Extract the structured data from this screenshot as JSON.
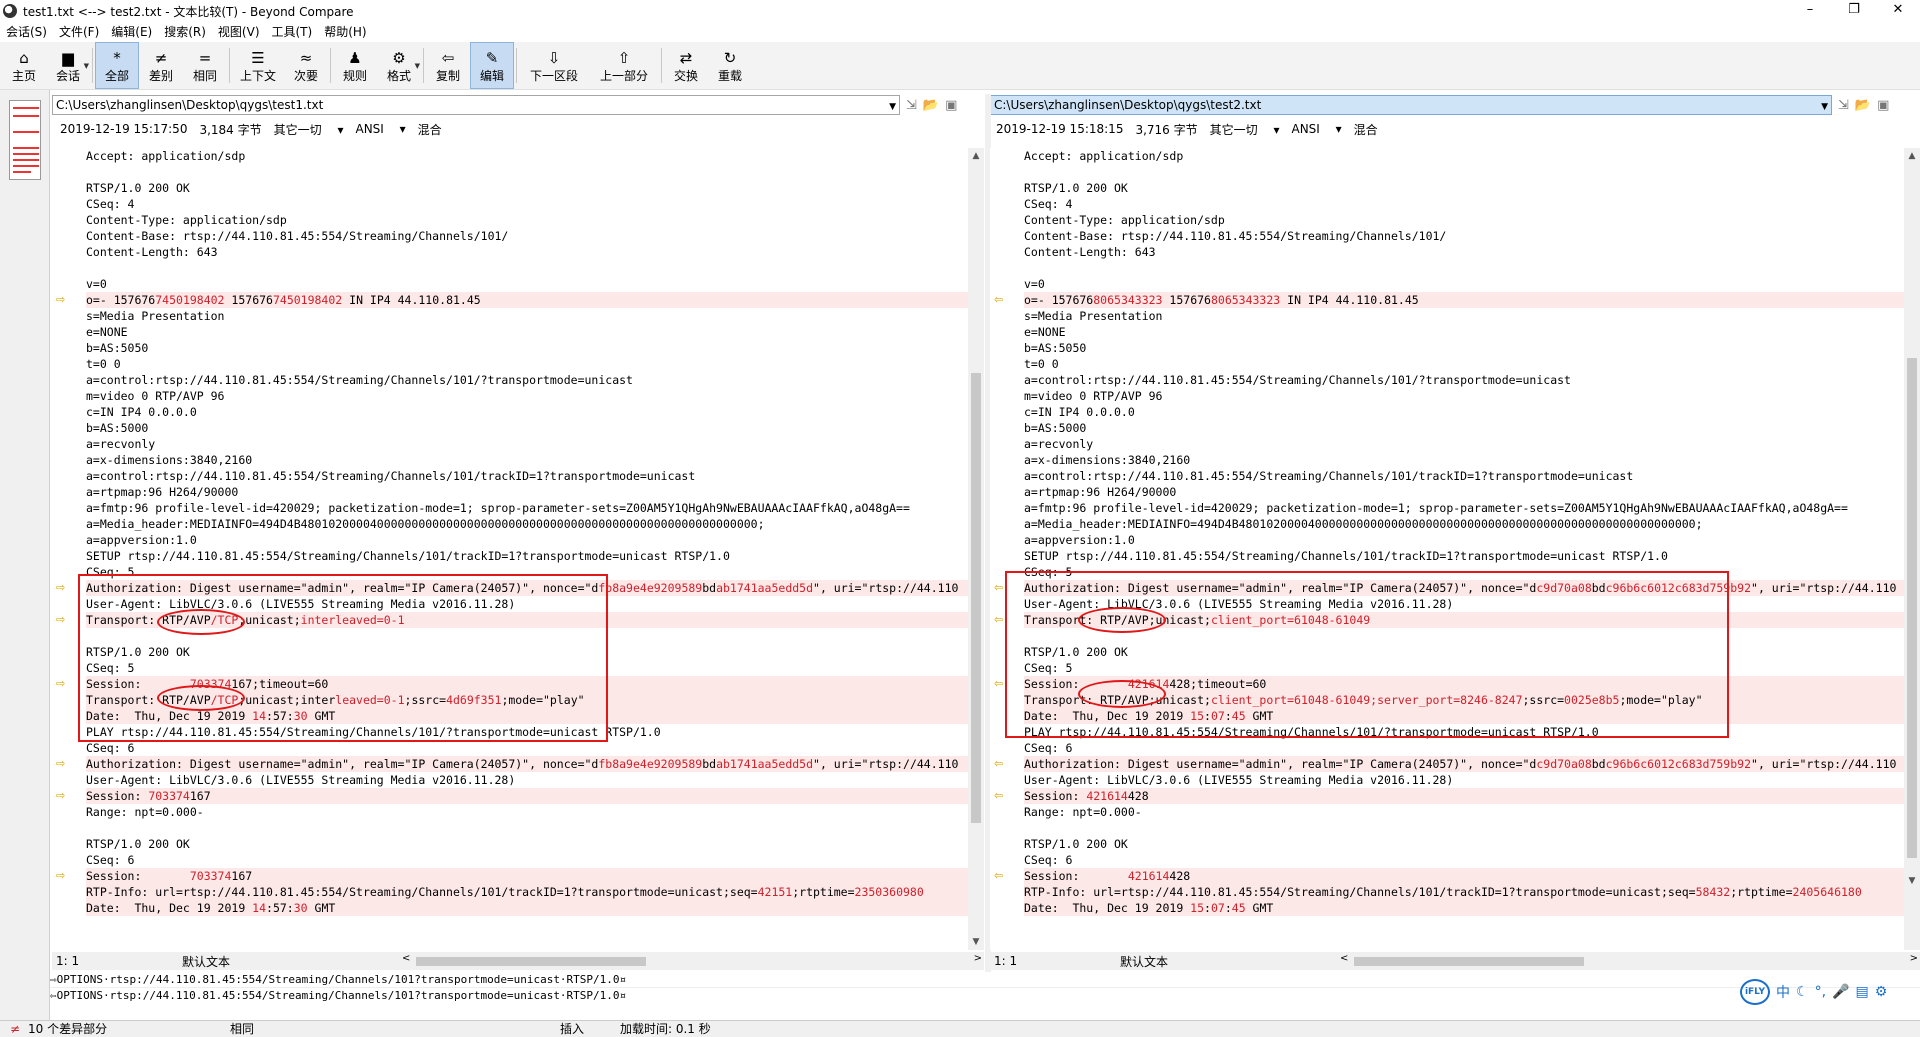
{
  "window": {
    "title": "test1.txt <--> test2.txt - 文本比较(T) - Beyond Compare",
    "controls": [
      "–",
      "❐",
      "✕"
    ]
  },
  "menu": [
    "会话(S)",
    "文件(F)",
    "编辑(E)",
    "搜索(R)",
    "视图(V)",
    "工具(T)",
    "帮助(H)"
  ],
  "toolbar": [
    {
      "label": "主页",
      "icon": "⌂",
      "name": "home"
    },
    {
      "label": "会话",
      "icon": "▆",
      "name": "session",
      "dropdown": true
    },
    {
      "label": "全部",
      "icon": "*",
      "name": "all",
      "active": true
    },
    {
      "label": "差别",
      "icon": "≠",
      "name": "diffs"
    },
    {
      "label": "相同",
      "icon": "=",
      "name": "same"
    },
    {
      "label": "上下文",
      "icon": "☰",
      "name": "context"
    },
    {
      "label": "次要",
      "icon": "≈",
      "name": "minor"
    },
    {
      "label": "规则",
      "icon": "♟",
      "name": "rules"
    },
    {
      "label": "格式",
      "icon": "⚙",
      "name": "format",
      "dropdown": true
    },
    {
      "label": "复制",
      "icon": "⇦",
      "name": "copy"
    },
    {
      "label": "编辑",
      "icon": "✎",
      "name": "edit",
      "active": true
    },
    {
      "label": "下一区段",
      "icon": "⇩",
      "name": "next-section"
    },
    {
      "label": "上一部分",
      "icon": "⇧",
      "name": "prev-section"
    },
    {
      "label": "交换",
      "icon": "⇄",
      "name": "swap"
    },
    {
      "label": "重载",
      "icon": "↻",
      "name": "reload"
    }
  ],
  "left": {
    "path": "C:\\Users\\zhanglinsen\\Desktop\\qygs\\test1.txt",
    "date": "2019-12-19 15:17:50",
    "size": "3,184 字节",
    "lineend": "其它一切",
    "encoding": "ANSI",
    "mode": "混合",
    "cursor": "1: 1",
    "textformat": "默认文本",
    "lines": [
      {
        "t": "Accept: application/sdp"
      },
      {
        "t": ""
      },
      {
        "t": "RTSP/1.0 200 OK"
      },
      {
        "t": "CSeq: 4"
      },
      {
        "t": "Content-Type: application/sdp"
      },
      {
        "t": "Content-Base: rtsp://44.110.81.45:554/Streaming/Channels/101/"
      },
      {
        "t": "Content-Length: 643"
      },
      {
        "t": ""
      },
      {
        "t": "v=0"
      },
      {
        "t": "o=- 1576767450198402 1576767450198402 IN IP4 44.110.81.45",
        "diff": true,
        "arrow": true,
        "hl": [
          [
            "o=- 157676",
            0
          ],
          [
            "7450198402",
            1
          ],
          [
            " 157676",
            0
          ],
          [
            "7450198402",
            1
          ],
          [
            " IN IP4 44.110.81.45",
            0
          ]
        ]
      },
      {
        "t": "s=Media Presentation"
      },
      {
        "t": "e=NONE"
      },
      {
        "t": "b=AS:5050"
      },
      {
        "t": "t=0 0"
      },
      {
        "t": "a=control:rtsp://44.110.81.45:554/Streaming/Channels/101/?transportmode=unicast"
      },
      {
        "t": "m=video 0 RTP/AVP 96"
      },
      {
        "t": "c=IN IP4 0.0.0.0"
      },
      {
        "t": "b=AS:5000"
      },
      {
        "t": "a=recvonly"
      },
      {
        "t": "a=x-dimensions:3840,2160"
      },
      {
        "t": "a=control:rtsp://44.110.81.45:554/Streaming/Channels/101/trackID=1?transportmode=unicast"
      },
      {
        "t": "a=rtpmap:96 H264/90000"
      },
      {
        "t": "a=fmtp:96 profile-level-id=420029; packetization-mode=1; sprop-parameter-sets=Z00AM5Y1QHgAh9NwEBAUAAAcIAAFfkAQ,aO48gA=="
      },
      {
        "t": "a=Media_header:MEDIAINFO=494D4B480102000040000000000000000000000000000000000000000000000000000000;"
      },
      {
        "t": "a=appversion:1.0"
      },
      {
        "t": "SETUP rtsp://44.110.81.45:554/Streaming/Channels/101/trackID=1?transportmode=unicast RTSP/1.0"
      },
      {
        "t": "CSeq: 5"
      },
      {
        "t": "Authorization: Digest username=\"admin\", realm=\"IP Camera(24057)\", nonce=\"dfb8a9e4e9209589bdab1741aa5edd5d\", uri=\"rtsp://44.110",
        "diff": true,
        "arrow": true,
        "hl": [
          [
            "Authorization: Digest username=\"admin\", realm=\"IP Camera(24057)\", nonce=\"d",
            0
          ],
          [
            "fb8a9e4e9209589",
            1
          ],
          [
            "bd",
            0
          ],
          [
            "ab1741aa5edd5d",
            1
          ],
          [
            "\", uri=\"rtsp://44.110",
            0
          ]
        ]
      },
      {
        "t": "User-Agent: LibVLC/3.0.6 (LIVE555 Streaming Media v2016.11.28)"
      },
      {
        "t": "Transport: RTP/AVP/TCP;unicast;interleaved=0-1",
        "diff": true,
        "arrow": true,
        "hl": [
          [
            "Transport: RTP/AVP",
            0
          ],
          [
            "/TCP",
            1
          ],
          [
            ";unicast;",
            0
          ],
          [
            "interleaved=0-1",
            1
          ]
        ]
      },
      {
        "t": ""
      },
      {
        "t": "RTSP/1.0 200 OK"
      },
      {
        "t": "CSeq: 5"
      },
      {
        "t": "Session:       703374167;timeout=60",
        "diff": true,
        "arrow": true,
        "hl": [
          [
            "Session:       ",
            0
          ],
          [
            "703374",
            1
          ],
          [
            "167;timeout=60",
            0
          ]
        ]
      },
      {
        "t": "Transport: RTP/AVP/TCP;unicast;interleaved=0-1;ssrc=4d69f351;mode=\"play\"",
        "diff": true,
        "hl": [
          [
            "Transport: RTP/AVP",
            0
          ],
          [
            "/TCP",
            1
          ],
          [
            ";unicast;inter",
            0
          ],
          [
            "leaved=0-1",
            1
          ],
          [
            ";ssrc=",
            0
          ],
          [
            "4d69f351",
            1
          ],
          [
            ";mode=\"play\"",
            0
          ]
        ]
      },
      {
        "t": "Date:  Thu, Dec 19 2019 14:57:30 GMT",
        "diff": true,
        "hl": [
          [
            "Date:  Thu, Dec 19 2019 ",
            0
          ],
          [
            "14",
            1
          ],
          [
            ":57:",
            0
          ],
          [
            "30",
            1
          ],
          [
            " GMT",
            0
          ]
        ]
      },
      {
        "t": "PLAY rtsp://44.110.81.45:554/Streaming/Channels/101/?transportmode=unicast RTSP/1.0"
      },
      {
        "t": "CSeq: 6"
      },
      {
        "t": "Authorization: Digest username=\"admin\", realm=\"IP Camera(24057)\", nonce=\"dfb8a9e4e9209589bdab1741aa5edd5d\", uri=\"rtsp://44.110",
        "diff": true,
        "arrow": true,
        "hl": [
          [
            "Authorization: Digest username=\"admin\", realm=\"IP Camera(24057)\", nonce=\"d",
            0
          ],
          [
            "fb8a9e4e9209589",
            1
          ],
          [
            "bd",
            0
          ],
          [
            "ab1741aa5edd5d",
            1
          ],
          [
            "\", uri=\"rtsp://44.110",
            0
          ]
        ]
      },
      {
        "t": "User-Agent: LibVLC/3.0.6 (LIVE555 Streaming Media v2016.11.28)"
      },
      {
        "t": "Session: 703374167",
        "diff": true,
        "arrow": true,
        "hl": [
          [
            "Session: ",
            0
          ],
          [
            "703374",
            1
          ],
          [
            "167",
            0
          ]
        ]
      },
      {
        "t": "Range: npt=0.000-"
      },
      {
        "t": ""
      },
      {
        "t": "RTSP/1.0 200 OK"
      },
      {
        "t": "CSeq: 6"
      },
      {
        "t": "Session:       703374167",
        "diff": true,
        "arrow": true,
        "hl": [
          [
            "Session:       ",
            0
          ],
          [
            "703374",
            1
          ],
          [
            "167",
            0
          ]
        ]
      },
      {
        "t": "RTP-Info: url=rtsp://44.110.81.45:554/Streaming/Channels/101/trackID=1?transportmode=unicast;seq=42151;rtptime=2350360980",
        "diff": true,
        "hl": [
          [
            "RTP-Info: url=rtsp://44.110.81.45:554/Streaming/Channels/101/trackID=1?transportmode=unicast;seq=",
            0
          ],
          [
            "42151",
            1
          ],
          [
            ";rtptime=",
            0
          ],
          [
            "2350360980",
            1
          ]
        ]
      },
      {
        "t": "Date:  Thu, Dec 19 2019 14:57:30 GMT",
        "diff": true,
        "hl": [
          [
            "Date:  Thu, Dec 19 2019 ",
            0
          ],
          [
            "14",
            1
          ],
          [
            ":57:",
            0
          ],
          [
            "30",
            1
          ],
          [
            " GMT",
            0
          ]
        ]
      }
    ]
  },
  "right": {
    "path": "C:\\Users\\zhanglinsen\\Desktop\\qygs\\test2.txt",
    "date": "2019-12-19 15:18:15",
    "size": "3,716 字节",
    "lineend": "其它一切",
    "encoding": "ANSI",
    "mode": "混合",
    "cursor": "1: 1",
    "textformat": "默认文本",
    "lines": [
      {
        "t": "Accept: application/sdp"
      },
      {
        "t": ""
      },
      {
        "t": "RTSP/1.0 200 OK"
      },
      {
        "t": "CSeq: 4"
      },
      {
        "t": "Content-Type: application/sdp"
      },
      {
        "t": "Content-Base: rtsp://44.110.81.45:554/Streaming/Channels/101/"
      },
      {
        "t": "Content-Length: 643"
      },
      {
        "t": ""
      },
      {
        "t": "v=0"
      },
      {
        "t": "o=- 1576768065343323 1576768065343323 IN IP4 44.110.81.45",
        "diff": true,
        "arrow": true,
        "hl": [
          [
            "o=- 157676",
            0
          ],
          [
            "8065343323",
            1
          ],
          [
            " 157676",
            0
          ],
          [
            "8065343323",
            1
          ],
          [
            " IN IP4 44.110.81.45",
            0
          ]
        ]
      },
      {
        "t": "s=Media Presentation"
      },
      {
        "t": "e=NONE"
      },
      {
        "t": "b=AS:5050"
      },
      {
        "t": "t=0 0"
      },
      {
        "t": "a=control:rtsp://44.110.81.45:554/Streaming/Channels/101/?transportmode=unicast"
      },
      {
        "t": "m=video 0 RTP/AVP 96"
      },
      {
        "t": "c=IN IP4 0.0.0.0"
      },
      {
        "t": "b=AS:5000"
      },
      {
        "t": "a=recvonly"
      },
      {
        "t": "a=x-dimensions:3840,2160"
      },
      {
        "t": "a=control:rtsp://44.110.81.45:554/Streaming/Channels/101/trackID=1?transportmode=unicast"
      },
      {
        "t": "a=rtpmap:96 H264/90000"
      },
      {
        "t": "a=fmtp:96 profile-level-id=420029; packetization-mode=1; sprop-parameter-sets=Z00AM5Y1QHgAh9NwEBAUAAAcIAAFfkAQ,aO48gA=="
      },
      {
        "t": "a=Media_header:MEDIAINFO=494D4B480102000040000000000000000000000000000000000000000000000000000000;"
      },
      {
        "t": "a=appversion:1.0"
      },
      {
        "t": "SETUP rtsp://44.110.81.45:554/Streaming/Channels/101/trackID=1?transportmode=unicast RTSP/1.0"
      },
      {
        "t": "CSeq: 5"
      },
      {
        "t": "Authorization: Digest username=\"admin\", realm=\"IP Camera(24057)\", nonce=\"dc9d70a08bdc96b6c6012c683d759b92\", uri=\"rtsp://44.110",
        "diff": true,
        "arrow": true,
        "hl": [
          [
            "Authorization: Digest username=\"admin\", realm=\"IP Camera(24057)\", nonce=\"d",
            0
          ],
          [
            "c9d70a08",
            1
          ],
          [
            "bd",
            0
          ],
          [
            "c96b6c6012c683d759b92",
            1
          ],
          [
            "\", uri=\"rtsp://44.110",
            0
          ]
        ]
      },
      {
        "t": "User-Agent: LibVLC/3.0.6 (LIVE555 Streaming Media v2016.11.28)"
      },
      {
        "t": "Transport: RTP/AVP;unicast;client_port=61048-61049",
        "diff": true,
        "arrow": true,
        "hl": [
          [
            "Transport: RTP/AVP;unicast;",
            0
          ],
          [
            "client_port=61048-61049",
            1
          ]
        ]
      },
      {
        "t": ""
      },
      {
        "t": "RTSP/1.0 200 OK"
      },
      {
        "t": "CSeq: 5"
      },
      {
        "t": "Session:       421614428;timeout=60",
        "diff": true,
        "arrow": true,
        "hl": [
          [
            "Session:       ",
            0
          ],
          [
            "421614",
            1
          ],
          [
            "428;timeout=60",
            0
          ]
        ]
      },
      {
        "t": "Transport: RTP/AVP;unicast;client_port=61048-61049;server_port=8246-8247;ssrc=0025e8b5;mode=\"play\"",
        "diff": true,
        "hl": [
          [
            "Transport: RTP/AVP;unicast;",
            0
          ],
          [
            "client_port=61048-61049;server_port=8246-8247",
            1
          ],
          [
            ";ssrc=",
            0
          ],
          [
            "0025e8b5",
            1
          ],
          [
            ";mode=\"play\"",
            0
          ]
        ]
      },
      {
        "t": "Date:  Thu, Dec 19 2019 15:07:45 GMT",
        "diff": true,
        "hl": [
          [
            "Date:  Thu, Dec 19 2019 ",
            0
          ],
          [
            "15",
            1
          ],
          [
            ":",
            0
          ],
          [
            "07",
            1
          ],
          [
            ":",
            0
          ],
          [
            "45",
            1
          ],
          [
            " GMT",
            0
          ]
        ]
      },
      {
        "t": "PLAY rtsp://44.110.81.45:554/Streaming/Channels/101/?transportmode=unicast RTSP/1.0"
      },
      {
        "t": "CSeq: 6"
      },
      {
        "t": "Authorization: Digest username=\"admin\", realm=\"IP Camera(24057)\", nonce=\"dc9d70a08bdc96b6c6012c683d759b92\", uri=\"rtsp://44.110",
        "diff": true,
        "arrow": true,
        "hl": [
          [
            "Authorization: Digest username=\"admin\", realm=\"IP Camera(24057)\", nonce=\"d",
            0
          ],
          [
            "c9d70a08",
            1
          ],
          [
            "bd",
            0
          ],
          [
            "c96b6c6012c683d759b92",
            1
          ],
          [
            "\", uri=\"rtsp://44.110",
            0
          ]
        ]
      },
      {
        "t": "User-Agent: LibVLC/3.0.6 (LIVE555 Streaming Media v2016.11.28)"
      },
      {
        "t": "Session: 421614428",
        "diff": true,
        "arrow": true,
        "hl": [
          [
            "Session: ",
            0
          ],
          [
            "421614",
            1
          ],
          [
            "428",
            0
          ]
        ]
      },
      {
        "t": "Range: npt=0.000-"
      },
      {
        "t": ""
      },
      {
        "t": "RTSP/1.0 200 OK"
      },
      {
        "t": "CSeq: 6"
      },
      {
        "t": "Session:       421614428",
        "diff": true,
        "arrow": true,
        "hl": [
          [
            "Session:       ",
            0
          ],
          [
            "421614",
            1
          ],
          [
            "428",
            0
          ]
        ]
      },
      {
        "t": "RTP-Info: url=rtsp://44.110.81.45:554/Streaming/Channels/101/trackID=1?transportmode=unicast;seq=58432;rtptime=2405646180",
        "diff": true,
        "hl": [
          [
            "RTP-Info: url=rtsp://44.110.81.45:554/Streaming/Channels/101/trackID=1?transportmode=unicast;seq=",
            0
          ],
          [
            "58432",
            1
          ],
          [
            ";rtptime=",
            0
          ],
          [
            "2405646180",
            1
          ]
        ]
      },
      {
        "t": "Date:  Thu, Dec 19 2019 15:07:45 GMT",
        "diff": true,
        "hl": [
          [
            "Date:  Thu, Dec 19 2019 ",
            0
          ],
          [
            "15",
            1
          ],
          [
            ":",
            0
          ],
          [
            "07",
            1
          ],
          [
            ":",
            0
          ],
          [
            "45",
            1
          ],
          [
            " GMT",
            0
          ]
        ]
      }
    ]
  },
  "bottom": {
    "line1": "⇨OPTIONS·rtsp://44.110.81.45:554/Streaming/Channels/101?transportmode=unicast·RTSP/1.0¤",
    "line2": "⇦OPTIONS·rtsp://44.110.81.45:554/Streaming/Channels/101?transportmode=unicast·RTSP/1.0¤"
  },
  "status": {
    "diffcount": "10 个差异部分",
    "same": "相同",
    "insert": "插入",
    "loadtime": "加载时间: 0.1 秒"
  },
  "ime": {
    "logo": "iFLY",
    "mode": "中",
    "icons": [
      "☾",
      "°,",
      "🎤",
      "▤",
      "⚙"
    ]
  },
  "colors": {
    "diff_bg": "#fde8e8",
    "diff_text": "#d0202b",
    "annotation": "#e01818",
    "accent": "#c7dcf2"
  }
}
